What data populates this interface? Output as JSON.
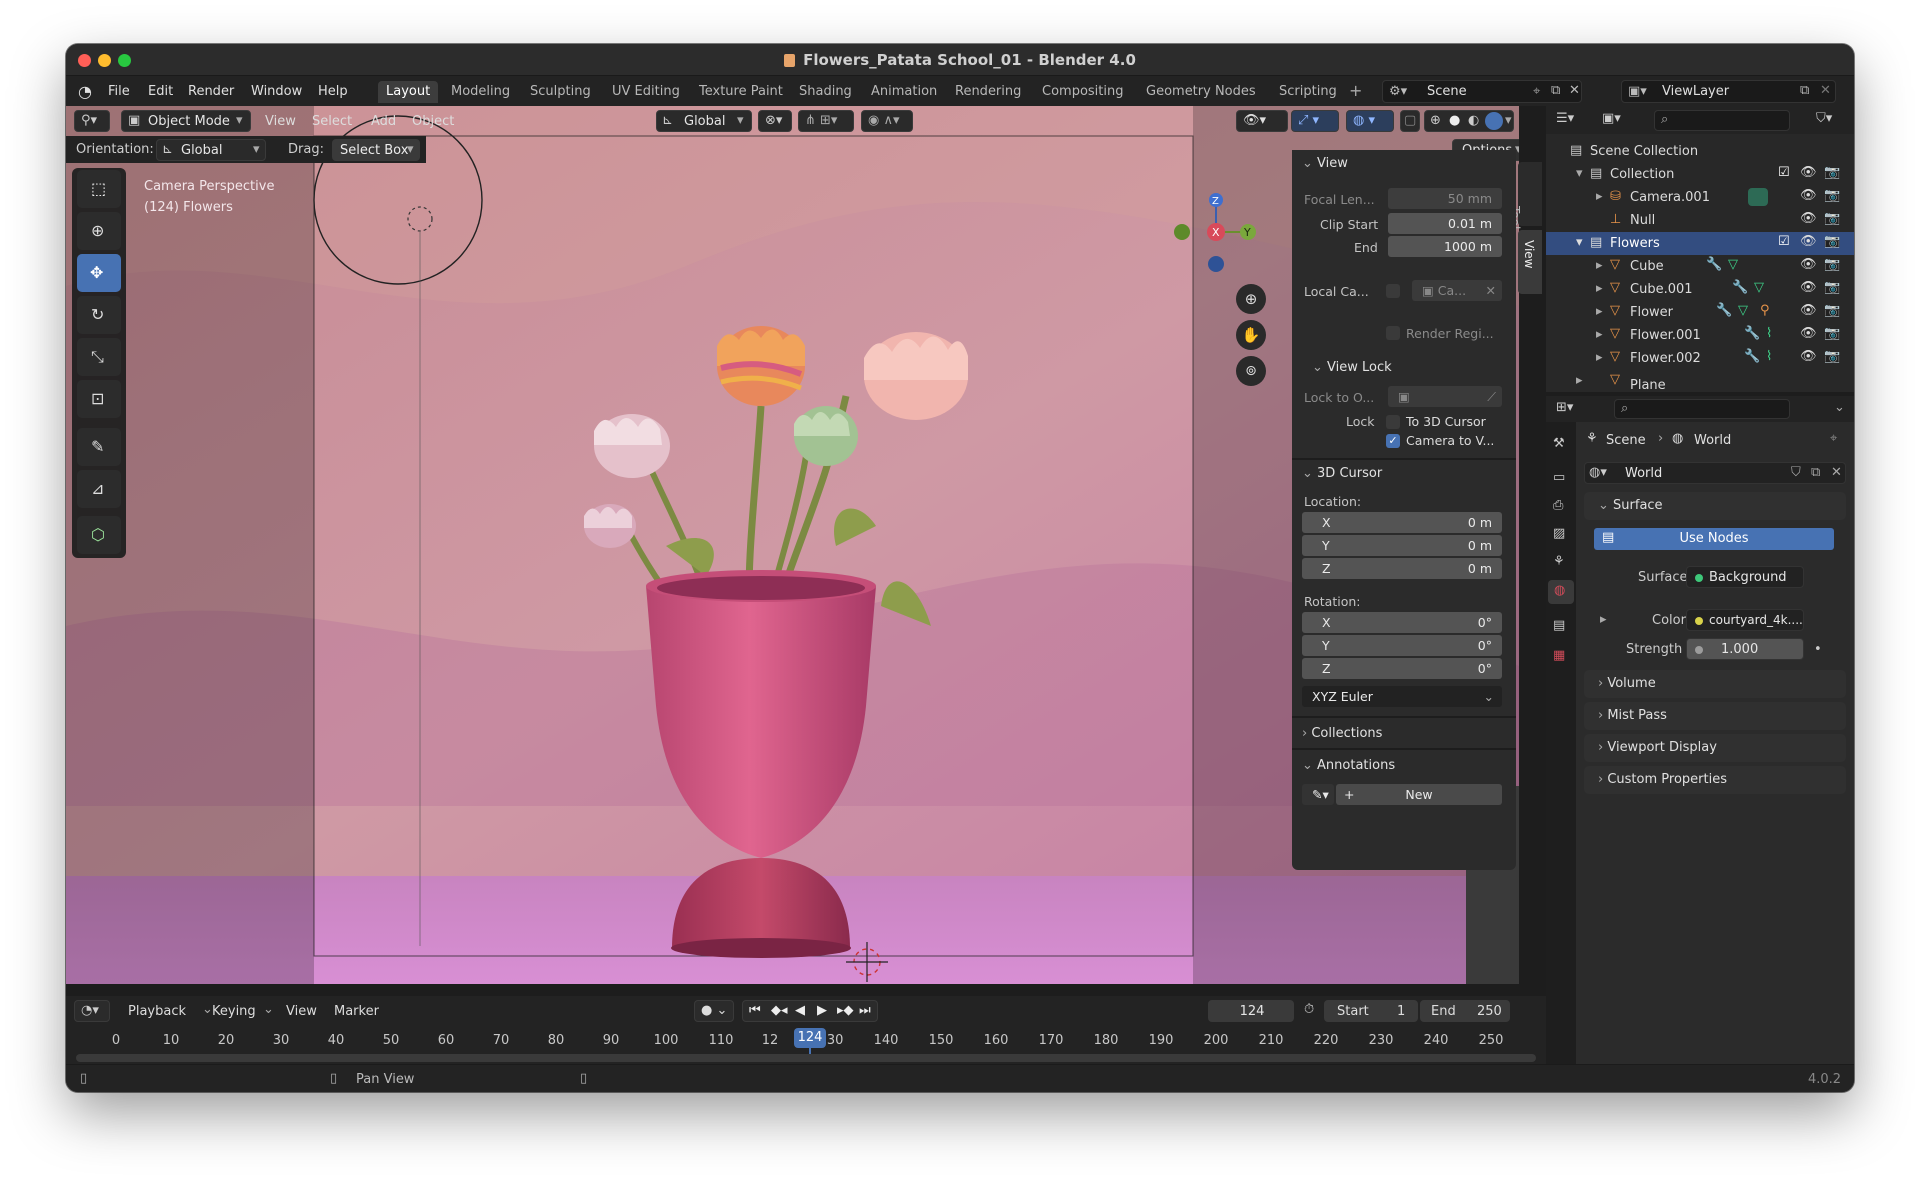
{
  "window": {
    "title": "Flowers_Patata School_01 - Blender 4.0",
    "version": "4.0.2"
  },
  "menubar": {
    "items": [
      "File",
      "Edit",
      "Render",
      "Window",
      "Help"
    ],
    "workspaces": [
      "Layout",
      "Modeling",
      "Sculpting",
      "UV Editing",
      "Texture Paint",
      "Shading",
      "Animation",
      "Rendering",
      "Compositing",
      "Geometry Nodes",
      "Scripting"
    ],
    "active_workspace": "Layout",
    "scene": "Scene",
    "view_layer": "ViewLayer"
  },
  "viewport_header": {
    "mode": "Object Mode",
    "menus": [
      "View",
      "Select",
      "Add",
      "Object"
    ],
    "transform_orientation": "Global",
    "orientation_label": "Orientation:",
    "orientation_value": "Global",
    "drag_label": "Drag:",
    "drag_value": "Select Box",
    "options": "Options"
  },
  "viewport": {
    "camera_text": "Camera Perspective",
    "frame_text": "(124) Flowers",
    "gizmo": {
      "x": "X",
      "y": "Y",
      "z": "Z"
    },
    "tabs": [
      "Tool",
      "View"
    ]
  },
  "npanel": {
    "view_header": "View",
    "focal_length_label": "Focal Len...",
    "focal_length_value": "50 mm",
    "clip_start_label": "Clip Start",
    "clip_start_value": "0.01 m",
    "clip_end_label": "End",
    "clip_end_value": "1000 m",
    "local_camera_label": "Local Ca...",
    "local_camera_value": "Ca...",
    "render_region": "Render Regi...",
    "view_lock_header": "View Lock",
    "lock_to_object": "Lock to O...",
    "lock_label": "Lock",
    "to_3d_cursor": "To 3D Cursor",
    "camera_to_view": "Camera to V...",
    "cursor_header": "3D Cursor",
    "location_label": "Location:",
    "location": [
      {
        "axis": "X",
        "value": "0 m"
      },
      {
        "axis": "Y",
        "value": "0 m"
      },
      {
        "axis": "Z",
        "value": "0 m"
      }
    ],
    "rotation_label": "Rotation:",
    "rotation": [
      {
        "axis": "X",
        "value": "0°"
      },
      {
        "axis": "Y",
        "value": "0°"
      },
      {
        "axis": "Z",
        "value": "0°"
      }
    ],
    "rotation_mode": "XYZ Euler",
    "collections_header": "Collections",
    "annotations_header": "Annotations",
    "new_button": "New"
  },
  "outliner": {
    "rows": [
      {
        "name": "Scene Collection"
      },
      {
        "name": "Collection"
      },
      {
        "name": "Camera.001"
      },
      {
        "name": "Null"
      },
      {
        "name": "Flowers"
      },
      {
        "name": "Cube"
      },
      {
        "name": "Cube.001"
      },
      {
        "name": "Flower"
      },
      {
        "name": "Flower.001"
      },
      {
        "name": "Flower.002"
      },
      {
        "name": "Plane"
      }
    ]
  },
  "properties": {
    "breadcrumb_scene": "Scene",
    "breadcrumb_world": "World",
    "world_name": "World",
    "surface_header": "Surface",
    "use_nodes": "Use Nodes",
    "surface_label": "Surface",
    "surface_value": "Background",
    "color_label": "Color",
    "color_value": "courtyard_4k....",
    "strength_label": "Strength",
    "strength_value": "1.000",
    "panels": [
      "Volume",
      "Mist Pass",
      "Viewport Display",
      "Custom Properties"
    ]
  },
  "timeline": {
    "menus": [
      "Playback",
      "Keying",
      "View",
      "Marker"
    ],
    "current_frame": "124",
    "start_label": "Start",
    "start_value": "1",
    "end_label": "End",
    "end_value": "250",
    "ticks": [
      "0",
      "10",
      "20",
      "30",
      "40",
      "50",
      "60",
      "70",
      "80",
      "90",
      "100",
      "110",
      "12",
      "130",
      "140",
      "150",
      "160",
      "170",
      "180",
      "190",
      "200",
      "210",
      "220",
      "230",
      "240",
      "250"
    ],
    "playhead": "124"
  },
  "status": {
    "pan_view": "Pan View",
    "version": "4.0.2"
  },
  "colors": {
    "accent": "#4772b3",
    "active_row": "#334d80",
    "red_light": "#ff5f57",
    "yellow_light": "#febc2e",
    "green_light": "#28c840"
  }
}
